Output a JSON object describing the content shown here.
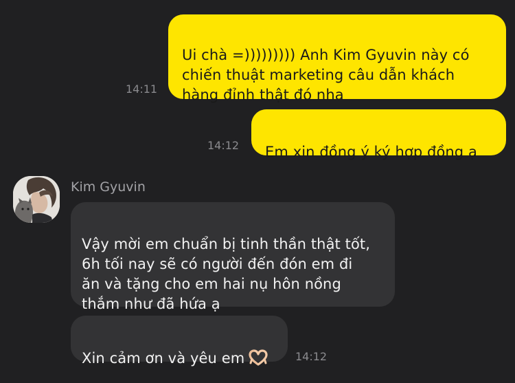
{
  "messages": [
    {
      "direction": "outgoing",
      "text": "Ui chà =))))))))) Anh Kim Gyuvin này có\nchiến thuật marketing câu dẫn khách\nhàng đỉnh thật đó nha",
      "time": "14:11"
    },
    {
      "direction": "outgoing",
      "text": "Em xin đồng ý ký hợp đồng ạ",
      "time": "14:12"
    },
    {
      "direction": "incoming",
      "sender": "Kim Gyuvin",
      "text": "Vậy mời em chuẩn bị tinh thần thật tốt,\n6h tối nay sẽ có người đến đón em đi\năn và tặng cho em hai nụ hôn nồng\nthắm như đã hứa ạ"
    },
    {
      "direction": "incoming",
      "text": "Xin cảm ơn và yêu em",
      "emoji": "heart-hands-icon",
      "time": "14:12"
    }
  ],
  "colors": {
    "background": "#202022",
    "outgoing_bubble": "#FEE500",
    "incoming_bubble": "#333335",
    "timestamp": "#8a8a8e",
    "sender_name": "#a3a3a7"
  }
}
